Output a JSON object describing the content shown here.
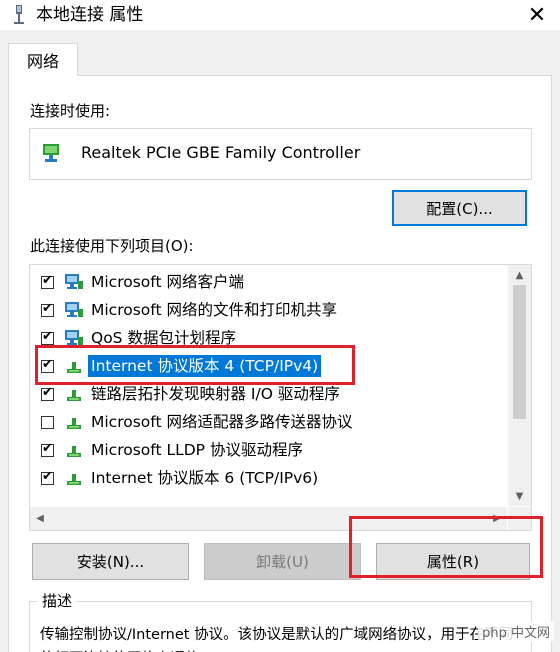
{
  "window": {
    "title": "本地连接 属性",
    "close_glyph": "✕"
  },
  "tabs": [
    {
      "label": "网络",
      "active": true
    }
  ],
  "connect_using": {
    "label": "连接时使用:",
    "adapter": "Realtek PCIe GBE Family Controller",
    "adapter_icon": "network-adapter-icon"
  },
  "buttons": {
    "configure": "配置(C)...",
    "install": "安装(N)...",
    "uninstall": "卸载(U)",
    "properties": "属性(R)"
  },
  "items_label": "此连接使用下列项目(O):",
  "items": [
    {
      "label": "Microsoft 网络客户端",
      "checked": true,
      "icon": "network-client-icon",
      "selected": false
    },
    {
      "label": "Microsoft 网络的文件和打印机共享",
      "checked": true,
      "icon": "network-client-icon",
      "selected": false
    },
    {
      "label": "QoS 数据包计划程序",
      "checked": true,
      "icon": "network-client-icon",
      "selected": false
    },
    {
      "label": "Internet 协议版本 4 (TCP/IPv4)",
      "checked": true,
      "icon": "protocol-icon",
      "selected": true
    },
    {
      "label": "链路层拓扑发现映射器 I/O 驱动程序",
      "checked": true,
      "icon": "protocol-icon",
      "selected": false
    },
    {
      "label": "Microsoft 网络适配器多路传送器协议",
      "checked": false,
      "icon": "protocol-icon",
      "selected": false
    },
    {
      "label": "Microsoft LLDP 协议驱动程序",
      "checked": true,
      "icon": "protocol-icon",
      "selected": false
    },
    {
      "label": "Internet 协议版本 6 (TCP/IPv6)",
      "checked": true,
      "icon": "protocol-icon",
      "selected": false
    }
  ],
  "description": {
    "title": "描述",
    "text": "传输控制协议/Internet 协议。该协议是默认的广域网络协议，用于在不同的相互连接的网络上通信。"
  },
  "watermark": "php 中文网",
  "colors": {
    "selection": "#0078d7",
    "annotation": "#e0202a"
  }
}
